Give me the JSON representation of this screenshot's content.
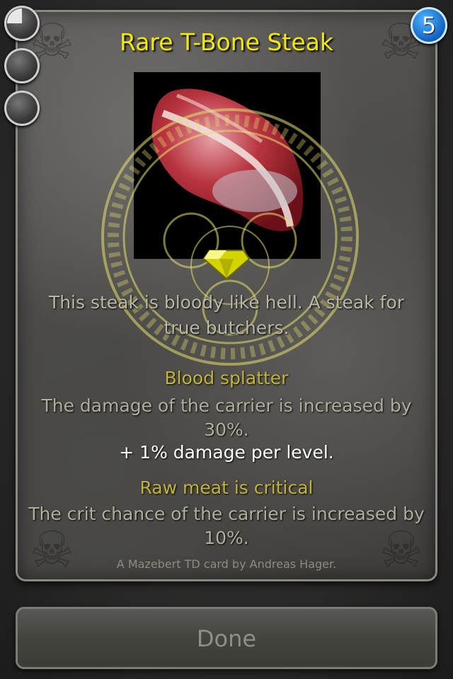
{
  "card": {
    "title": "Rare T-Bone Steak",
    "description": "This steak is bloody like hell. A steak for true butchers.",
    "level": "5",
    "abilities": [
      {
        "name": "Blood splatter",
        "text": "The damage of the carrier is increased by 30%.",
        "bonus": "+ 1% damage per level."
      },
      {
        "name": "Raw meat is critical",
        "text": "The crit chance of the carrier is increased by 10%."
      }
    ],
    "credits": "A Mazebert TD card by Andreas Hager.",
    "rarity_icon": "rare-gem-icon",
    "item_image": "steak-icon"
  },
  "indicators": [
    {
      "name": "slot-indicator",
      "filled": true
    },
    {
      "name": "slot-indicator",
      "filled": false
    },
    {
      "name": "slot-indicator",
      "filled": false
    }
  ],
  "buttons": {
    "done_label": "Done"
  },
  "colors": {
    "title": "#f2e800",
    "ability_name": "#c2b43a",
    "body_text": "#b0ae9e",
    "bonus_text": "#ffffff",
    "level_badge": "#1466c4",
    "rune_glow": "#e8e070"
  }
}
